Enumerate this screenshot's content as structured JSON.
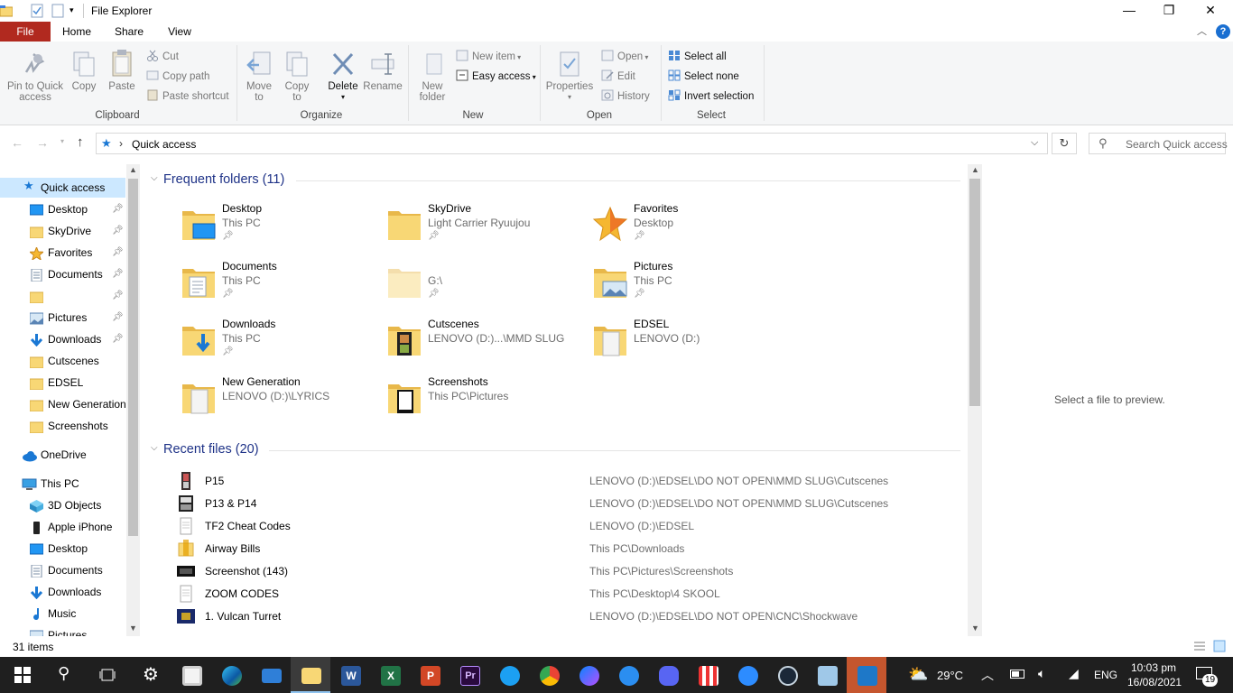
{
  "window": {
    "title": "File Explorer",
    "minimize": "—",
    "maximize": "❐",
    "close": "✕"
  },
  "tabs": [
    {
      "label": "File"
    },
    {
      "label": "Home"
    },
    {
      "label": "Share"
    },
    {
      "label": "View"
    }
  ],
  "ribbon": {
    "clipboard": {
      "pin_label": [
        "Pin to Quick",
        "access"
      ],
      "copy_label": "Copy",
      "paste_label": "Paste",
      "cut_label": "Cut",
      "copy_path_label": "Copy path",
      "paste_shortcut_label": "Paste shortcut",
      "caption": "Clipboard"
    },
    "organize": {
      "move_label": [
        "Move",
        "to"
      ],
      "copy_label": [
        "Copy",
        "to"
      ],
      "delete_label": "Delete",
      "rename_label": "Rename",
      "caption": "Organize"
    },
    "new": {
      "folder_label": [
        "New",
        "folder"
      ],
      "new_item_label": "New item",
      "easy_access_label": "Easy access",
      "caption": "New"
    },
    "open": {
      "properties_label": "Properties",
      "open_label": "Open",
      "edit_label": "Edit",
      "history_label": "History",
      "caption": "Open"
    },
    "select": {
      "select_all_label": "Select all",
      "select_none_label": "Select none",
      "invert_label": "Invert selection",
      "caption": "Select"
    }
  },
  "address": {
    "location": "Quick access",
    "separator": "›",
    "search_placeholder": "Search Quick access"
  },
  "navpane": {
    "quick_access": "Quick access",
    "pinned": [
      {
        "label": "Desktop",
        "icon": "desktop-icon"
      },
      {
        "label": "SkyDrive",
        "icon": "folder-icon"
      },
      {
        "label": "Favorites",
        "icon": "star-icon"
      },
      {
        "label": "Documents",
        "icon": "documents-icon"
      },
      {
        "label": "",
        "icon": "folder-icon"
      },
      {
        "label": "Pictures",
        "icon": "pictures-icon"
      },
      {
        "label": "Downloads",
        "icon": "download-icon"
      }
    ],
    "recent": [
      {
        "label": "Cutscenes"
      },
      {
        "label": "EDSEL"
      },
      {
        "label": "New Generation"
      },
      {
        "label": "Screenshots"
      }
    ],
    "onedrive": "OneDrive",
    "this_pc": "This PC",
    "pc_items": [
      {
        "label": "3D Objects"
      },
      {
        "label": "Apple iPhone"
      },
      {
        "label": "Desktop"
      },
      {
        "label": "Documents"
      },
      {
        "label": "Downloads"
      },
      {
        "label": "Music"
      },
      {
        "label": "Pictures"
      }
    ]
  },
  "frequent": {
    "title": "Frequent folders (11)",
    "folders": [
      {
        "name": "Desktop",
        "path": "This PC",
        "pinned": true
      },
      {
        "name": "SkyDrive",
        "path": "Light Carrier Ryuujou",
        "pinned": true
      },
      {
        "name": "Favorites",
        "path": "Desktop",
        "pinned": true
      },
      {
        "name": "Documents",
        "path": "This PC",
        "pinned": true
      },
      {
        "name": "",
        "path": "G:\\",
        "pinned": true
      },
      {
        "name": "Pictures",
        "path": "This PC",
        "pinned": true
      },
      {
        "name": "Downloads",
        "path": "This PC",
        "pinned": true
      },
      {
        "name": "Cutscenes",
        "path": "LENOVO (D:)...\\MMD SLUG",
        "pinned": false
      },
      {
        "name": "EDSEL",
        "path": "LENOVO (D:)",
        "pinned": false
      },
      {
        "name": "New Generation",
        "path": "LENOVO (D:)\\LYRICS",
        "pinned": false
      },
      {
        "name": "Screenshots",
        "path": "This PC\\Pictures",
        "pinned": false
      }
    ]
  },
  "recent_files": {
    "title": "Recent files (20)",
    "files": [
      {
        "name": "P15",
        "location": "LENOVO (D:)\\EDSEL\\DO NOT OPEN\\MMD SLUG\\Cutscenes"
      },
      {
        "name": "P13 & P14",
        "location": "LENOVO (D:)\\EDSEL\\DO NOT OPEN\\MMD SLUG\\Cutscenes"
      },
      {
        "name": "TF2 Cheat Codes",
        "location": "LENOVO (D:)\\EDSEL"
      },
      {
        "name": "Airway Bills",
        "location": "This PC\\Downloads"
      },
      {
        "name": "Screenshot (143)",
        "location": "This PC\\Pictures\\Screenshots"
      },
      {
        "name": "ZOOM CODES",
        "location": "This PC\\Desktop\\4 SKOOL"
      },
      {
        "name": "1. Vulcan Turret",
        "location": "LENOVO (D:)\\EDSEL\\DO NOT OPEN\\CNC\\Shockwave"
      }
    ]
  },
  "preview": {
    "text": "Select a file to preview."
  },
  "status": {
    "count": "31 items"
  },
  "taskbar": {
    "weather": "29°C",
    "lang": "ENG",
    "time": "10:03 pm",
    "date": "16/08/2021",
    "notifications": "19"
  },
  "colors": {
    "file_tab": "#b1291f",
    "accent": "#0078d7",
    "folder": "#f8d775",
    "section_title": "#1e3287",
    "taskbar": "#1f1f1f"
  }
}
